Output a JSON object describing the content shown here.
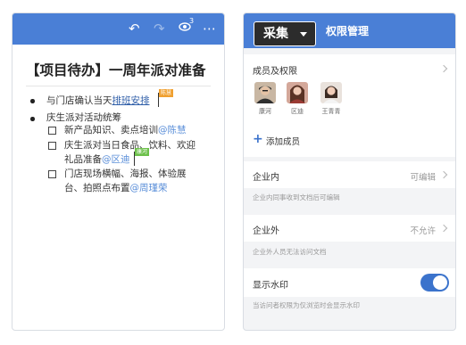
{
  "left_phone": {
    "toolbar": {
      "undo_icon": "undo-icon",
      "redo_icon": "redo-icon",
      "view_icon": "eye-icon",
      "viewer_count": "3",
      "more_icon": "more-icon"
    },
    "title": "【项目待办】一周年派对准备",
    "bullets": [
      {
        "text_prefix": "与门店确认当天",
        "link": "排班安排",
        "collab_tag": "陈慧"
      },
      {
        "text": "庆生派对活动统筹"
      }
    ],
    "todos": [
      {
        "lines": [
          "新产品知识、卖点培训"
        ],
        "mention": "@陈慧"
      },
      {
        "lines": [
          "庆生派对当日食品、饮料、欢迎",
          "礼品准备"
        ],
        "mention": "@区迪",
        "collab_tag": "康河"
      },
      {
        "lines": [
          "门店现场横幅、海报、体验展",
          "台、拍照点布置"
        ],
        "mention": "@周瑾荣"
      }
    ]
  },
  "right_phone": {
    "header_title": "权限管理",
    "collect_button": "采集",
    "members": {
      "label": "成员及权限",
      "people": [
        {
          "name": "康河"
        },
        {
          "name": "区迪"
        },
        {
          "name": "王青青"
        }
      ],
      "add_label": "添加成员"
    },
    "internal": {
      "label": "企业内",
      "value": "可编辑",
      "hint": "企业内同事收到文档后可编辑"
    },
    "external": {
      "label": "企业外",
      "value": "不允许",
      "hint": "企业外人员无法访问文档"
    },
    "watermark": {
      "label": "显示水印",
      "enabled": true,
      "hint": "当访问者权限为仅浏览时会显示水印"
    }
  },
  "colors": {
    "header_blue": "#4a7fd6",
    "accent_blue": "#3b73cc",
    "mention_blue": "#5b8fd9",
    "tag_orange": "#f0a030",
    "tag_green": "#6cc04a"
  }
}
